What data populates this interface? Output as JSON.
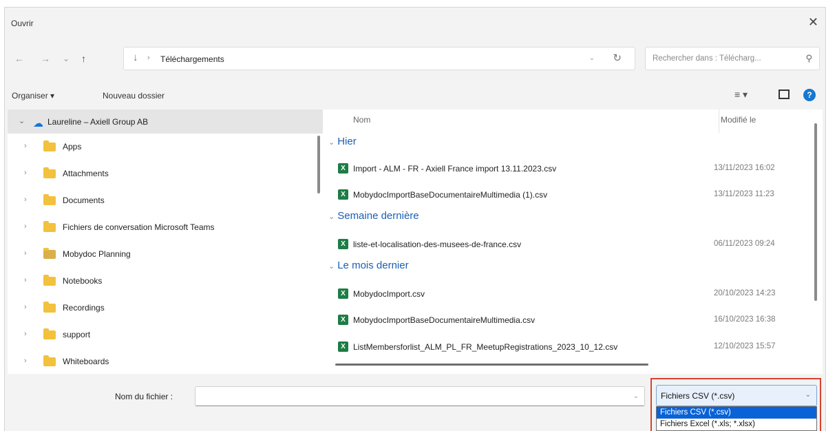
{
  "window": {
    "title": "Ouvrir",
    "close_label": "✕"
  },
  "nav": {
    "back": "←",
    "forward": "→",
    "recent": "⌄",
    "up": "↑",
    "path": "Téléchargements",
    "search_placeholder": "Rechercher dans : Télécharg..."
  },
  "toolbar": {
    "organize": "Organiser ▾",
    "new_folder": "Nouveau dossier"
  },
  "sidebar": {
    "root": "Laureline – Axiell Group AB",
    "items": [
      {
        "label": "Apps"
      },
      {
        "label": "Attachments"
      },
      {
        "label": "Documents"
      },
      {
        "label": "Fichiers de conversation Microsoft Teams"
      },
      {
        "label": "Mobydoc Planning"
      },
      {
        "label": "Notebooks"
      },
      {
        "label": "Recordings"
      },
      {
        "label": "support"
      },
      {
        "label": "Whiteboards"
      }
    ]
  },
  "files": {
    "headers": {
      "name": "Nom",
      "modified": "Modifié le"
    },
    "groups": [
      {
        "label": "Hier",
        "rows": [
          {
            "name": "Import - ALM - FR - Axiell France import 13.11.2023.csv",
            "date": "13/11/2023 16:02"
          },
          {
            "name": "MobydocImportBaseDocumentaireMultimedia (1).csv",
            "date": "13/11/2023 11:23"
          }
        ]
      },
      {
        "label": "Semaine dernière",
        "rows": [
          {
            "name": "liste-et-localisation-des-musees-de-france.csv",
            "date": "06/11/2023 09:24"
          }
        ]
      },
      {
        "label": "Le mois dernier",
        "rows": [
          {
            "name": "MobydocImport.csv",
            "date": "20/10/2023 14:23"
          },
          {
            "name": "MobydocImportBaseDocumentaireMultimedia.csv",
            "date": "16/10/2023 16:38"
          },
          {
            "name": "ListMembersforlist_ALM_PL_FR_MeetupRegistrations_2023_10_12.csv",
            "date": "12/10/2023 15:57"
          }
        ]
      }
    ]
  },
  "footer": {
    "filename_label": "Nom du fichier :",
    "filename_value": "",
    "filetype_selected": "Fichiers CSV (*.csv)",
    "filetype_options": [
      "Fichiers CSV (*.csv)",
      "Fichiers Excel (*.xls; *.xlsx)"
    ]
  },
  "colors": {
    "accent": "#0a63d6",
    "highlight_box": "#d9412d",
    "group_header": "#1a5fb4",
    "excel_icon": "#1d7d45"
  }
}
